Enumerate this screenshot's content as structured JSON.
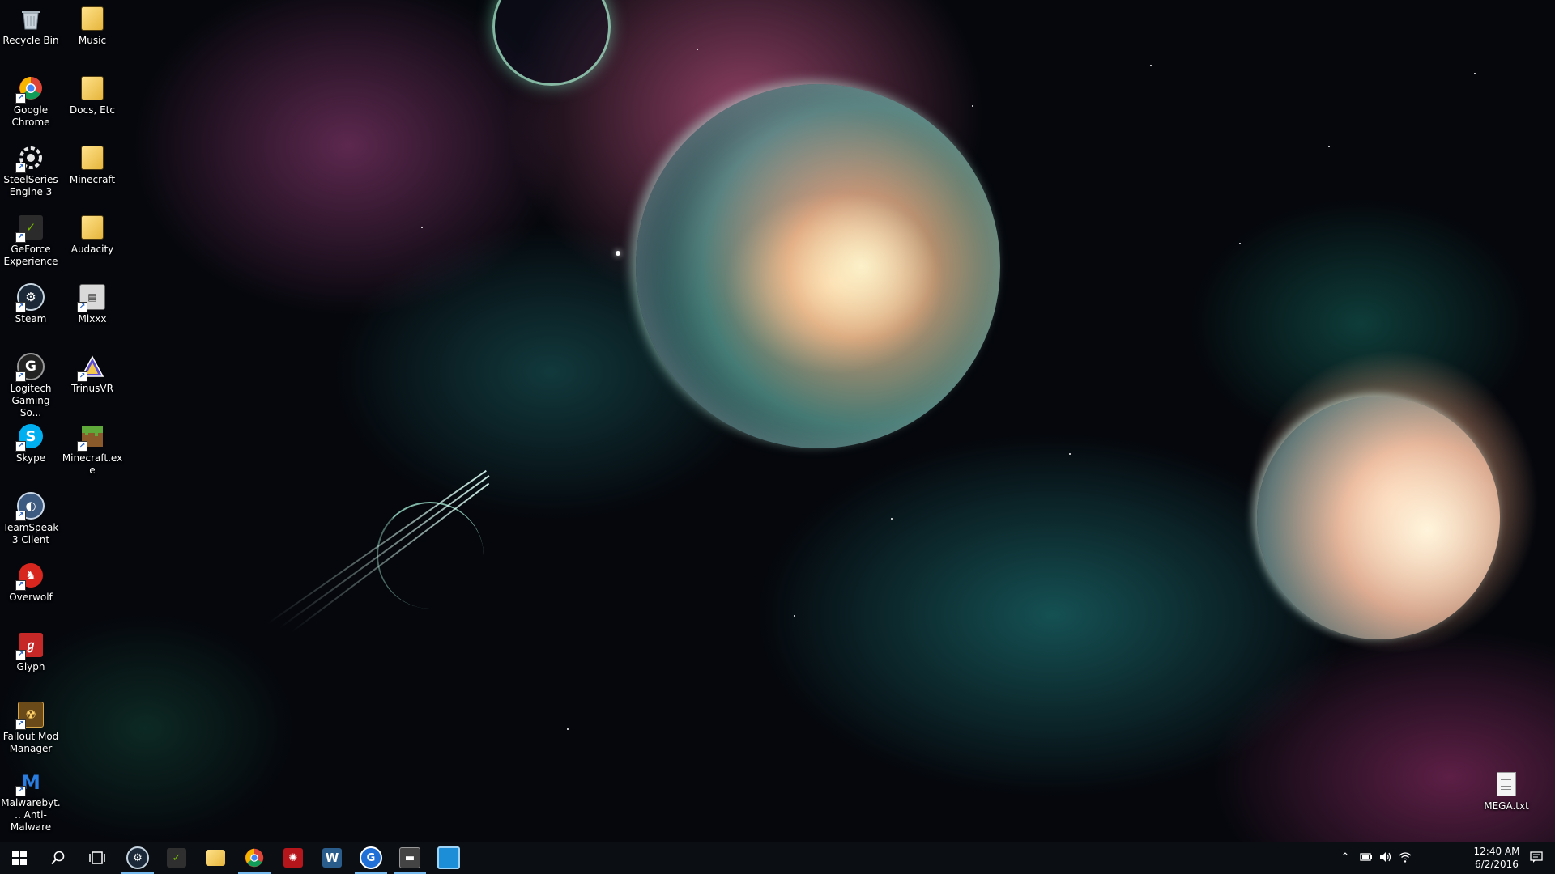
{
  "desktop": {
    "icons_left_column": [
      {
        "label": "Recycle Bin",
        "icon": "recycle-bin-icon"
      },
      {
        "label": "Google Chrome",
        "icon": "chrome-icon"
      },
      {
        "label": "SteelSeries Engine 3",
        "icon": "steelseries-icon"
      },
      {
        "label": "GeForce Experience",
        "icon": "geforce-icon"
      },
      {
        "label": "Steam",
        "icon": "steam-icon"
      },
      {
        "label": "Logitech Gaming So...",
        "icon": "logitech-icon"
      },
      {
        "label": "Skype",
        "icon": "skype-icon"
      },
      {
        "label": "TeamSpeak 3 Client",
        "icon": "teamspeak-icon"
      },
      {
        "label": "Overwolf",
        "icon": "overwolf-icon"
      },
      {
        "label": "Glyph",
        "icon": "glyph-icon"
      },
      {
        "label": "Fallout Mod Manager",
        "icon": "fallout-mod-manager-icon"
      },
      {
        "label": "Malwarebyt... Anti-Malware",
        "icon": "malwarebytes-icon"
      }
    ],
    "icons_right_column": [
      {
        "label": "Music",
        "icon": "folder-icon"
      },
      {
        "label": "Docs, Etc",
        "icon": "folder-icon"
      },
      {
        "label": "Minecraft",
        "icon": "folder-icon"
      },
      {
        "label": "Audacity",
        "icon": "folder-icon"
      },
      {
        "label": "Mixxx",
        "icon": "mixxx-icon"
      },
      {
        "label": "TrinusVR",
        "icon": "trinusvr-icon"
      },
      {
        "label": "Minecraft.exe",
        "icon": "minecraft-icon"
      }
    ],
    "file_right": {
      "label": "MEGA.txt",
      "icon": "text-file-icon"
    }
  },
  "taskbar": {
    "start_icon": "windows-start-icon",
    "search_icon": "search-icon",
    "task_view_icon": "task-view-icon",
    "pinned": [
      {
        "name": "steam",
        "icon": "steam-icon",
        "letter": "S",
        "color": "#1b2838",
        "running": true
      },
      {
        "name": "geforce",
        "icon": "geforce-icon",
        "letter": "G",
        "color": "#2f6f1f",
        "running": false
      },
      {
        "name": "file-explorer",
        "icon": "folder-icon",
        "letter": "",
        "color": "#e8b43a",
        "running": false
      },
      {
        "name": "chrome",
        "icon": "chrome-icon",
        "letter": "",
        "color": "#db4437",
        "running": true
      },
      {
        "name": "razer",
        "icon": "razer-icon",
        "letter": "R",
        "color": "#b5161b",
        "running": false
      },
      {
        "name": "winamp",
        "icon": "w-app-icon",
        "letter": "W",
        "color": "#2a5d8c",
        "running": false
      },
      {
        "name": "logitech-g",
        "icon": "g-app-icon",
        "letter": "G",
        "color": "#1f6fd6",
        "running": true
      },
      {
        "name": "app-dark",
        "icon": "window-app-icon",
        "letter": "",
        "color": "#555555",
        "running": true
      },
      {
        "name": "app-blue",
        "icon": "blue-window-icon",
        "letter": "",
        "color": "#1c8ed8",
        "running": false
      }
    ],
    "tray": {
      "chevron_icon": "chevron-up-icon",
      "power_icon": "battery-icon",
      "volume_icon": "volume-icon",
      "network_icon": "wifi-icon",
      "notifications_icon": "action-center-icon"
    },
    "clock": {
      "time": "12:40 AM",
      "date": "6/2/2016"
    }
  },
  "colors": {
    "taskbar_bg": "#0b0f14",
    "running_indicator": "#76b9ed"
  }
}
